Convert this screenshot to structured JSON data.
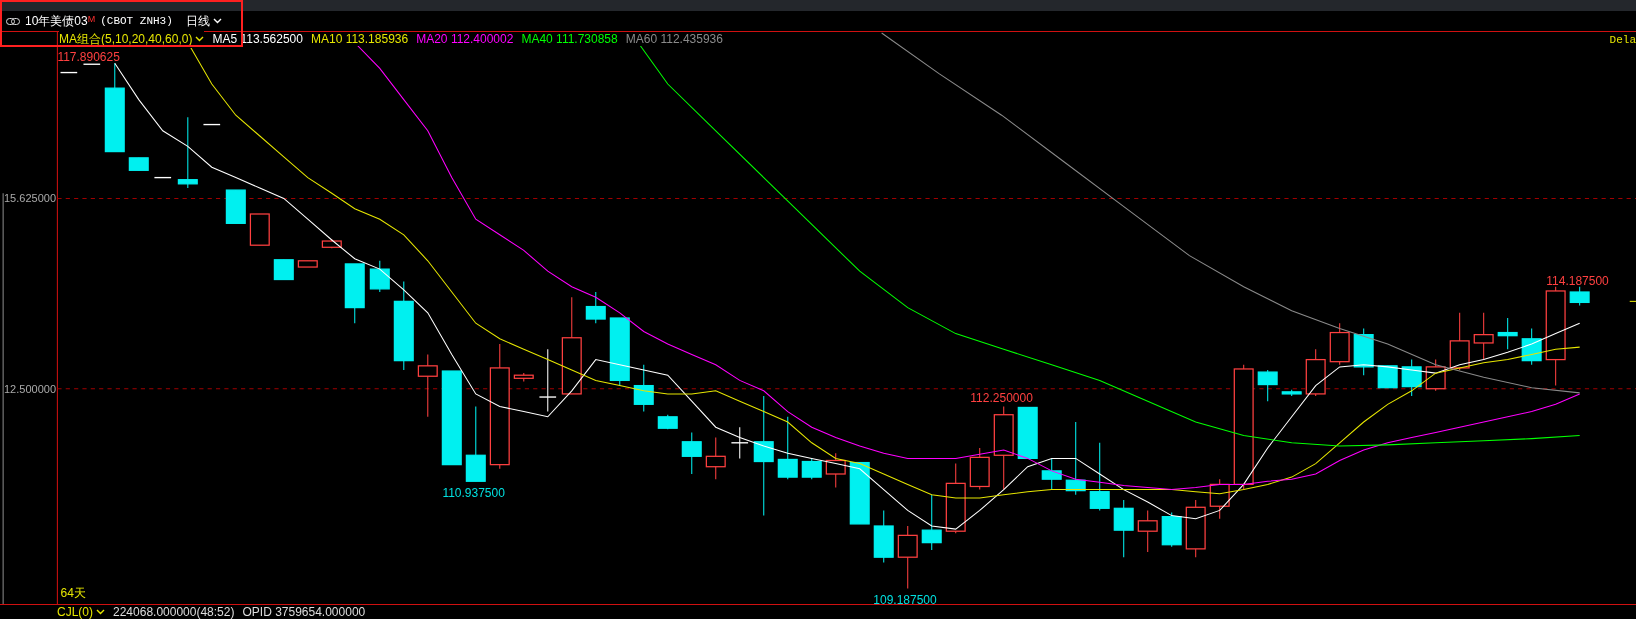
{
  "symbol": {
    "name": "10年美债03",
    "marker": "M",
    "code": "(CBOT ZNH3)",
    "period": "日线"
  },
  "ma_legend": {
    "label": "MA组合(5,10,20,40,60,0)",
    "items": [
      {
        "name": "MA5",
        "value": "113.562500",
        "color": "#ffffff"
      },
      {
        "name": "MA10",
        "value": "113.185936",
        "color": "#e6e600"
      },
      {
        "name": "MA20",
        "value": "112.400002",
        "color": "#ff00ff"
      },
      {
        "name": "MA40",
        "value": "111.730858",
        "color": "#00ff00"
      },
      {
        "name": "MA60",
        "value": "112.435936",
        "color": "#8a8a8a"
      }
    ]
  },
  "delay_label": "Dela",
  "price_axis": [
    "15.625000",
    "12.500000"
  ],
  "price_labels": [
    {
      "text": "117.890625",
      "kind": "high"
    },
    {
      "text": "114.187500",
      "kind": "high"
    },
    {
      "text": "112.250000",
      "kind": "high"
    },
    {
      "text": "110.937500",
      "kind": "low"
    },
    {
      "text": "109.187500",
      "kind": "low"
    }
  ],
  "days_label": "64天",
  "volume": {
    "label": "CJL(0)",
    "value": "224068.000000(48:52)",
    "opid": "OPID 3759654.000000"
  }
}
